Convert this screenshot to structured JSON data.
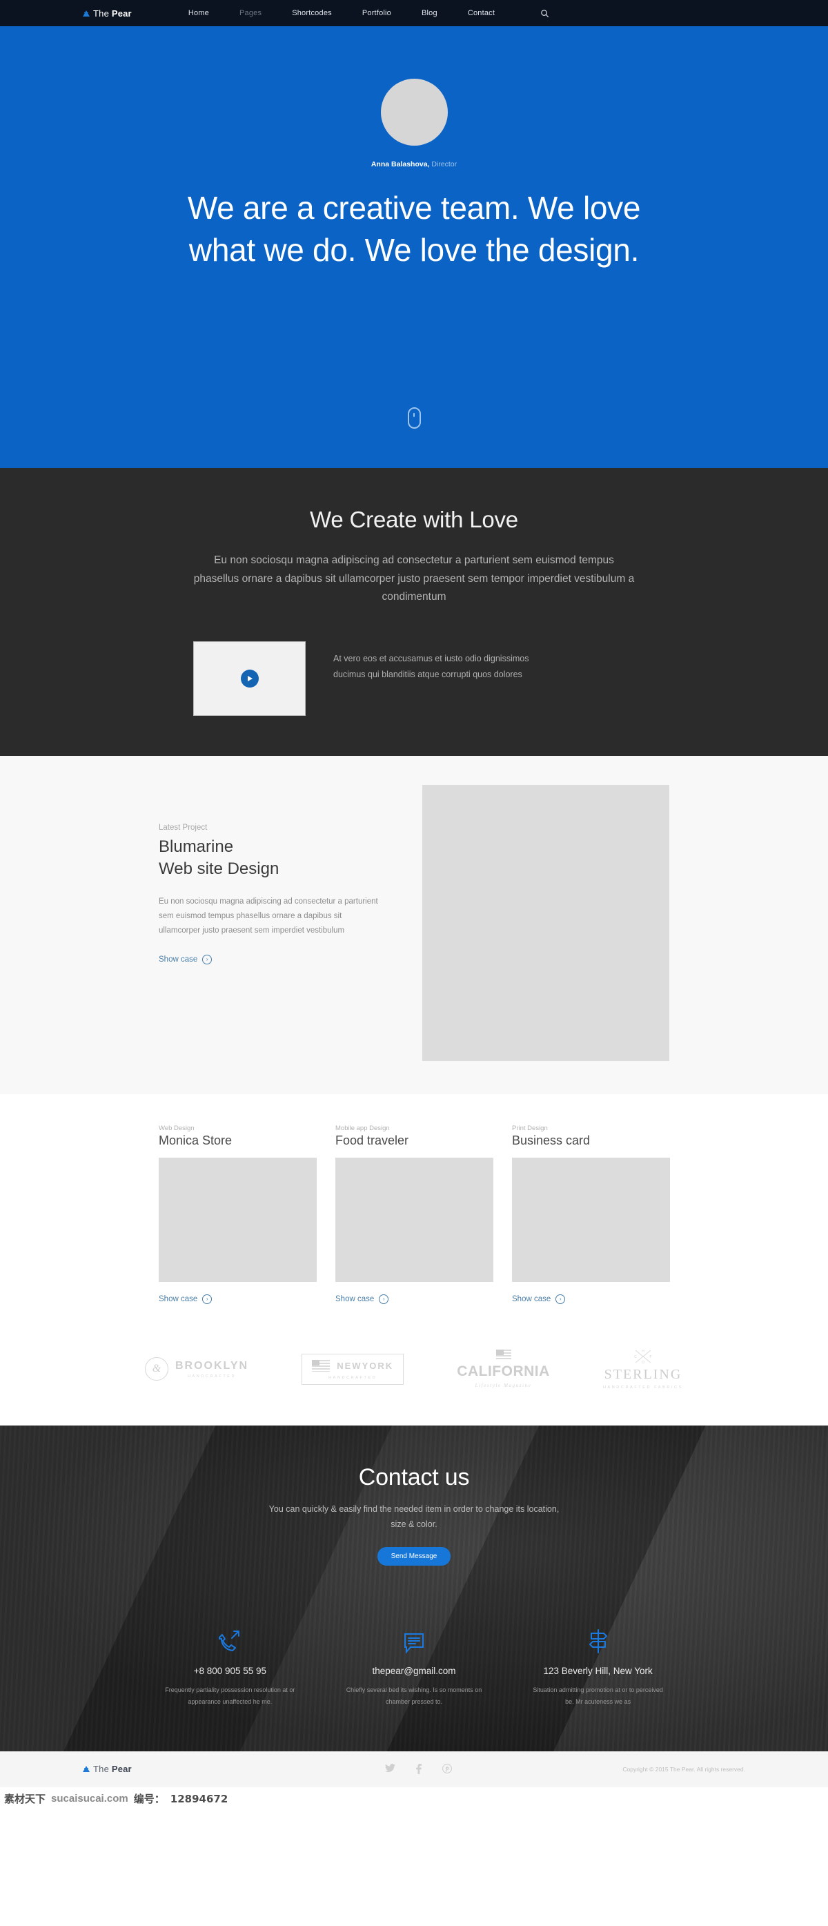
{
  "colors": {
    "hero_blue": "#0b63c5",
    "accent_blue": "#1677d8",
    "dark": "#2b2b2b",
    "link_blue": "#4a7fa8"
  },
  "nav": {
    "logo_prefix": "The ",
    "logo_bold": "Pear",
    "links": [
      {
        "label": "Home",
        "dim": false
      },
      {
        "label": "Pages",
        "dim": true
      },
      {
        "label": "Shortcodes",
        "dim": false
      },
      {
        "label": "Portfolio",
        "dim": false
      },
      {
        "label": "Blog",
        "dim": false
      },
      {
        "label": "Contact",
        "dim": false
      }
    ],
    "search_icon": "search-icon"
  },
  "hero": {
    "person_name": "Anna Balashova,",
    "person_role": " Director",
    "title": "We are a creative team. We love what we do. We love the design.",
    "scroll_icon": "mouse-scroll-icon"
  },
  "create": {
    "heading": "We Create with Love",
    "paragraph": "Eu non sociosqu magna adipiscing ad consectetur a parturient sem euismod tempus phasellus ornare a dapibus sit ullamcorper justo praesent sem tempor imperdiet vestibulum a condimentum",
    "play_icon": "play-icon",
    "video_text": "At vero eos et accusamus et iusto odio dignissimos ducimus qui blanditiis atque corrupti quos dolores"
  },
  "latest": {
    "eyebrow": "Latest Project",
    "title_line1": "Blumarine",
    "title_line2": "Web site Design",
    "paragraph": "Eu non sociosqu magna adipiscing ad consectetur a parturient sem euismod tempus phasellus ornare a dapibus sit ullamcorper justo praesent sem imperdiet vestibulum",
    "showcase_label": "Show case"
  },
  "cards": {
    "showcase_label": "Show case",
    "items": [
      {
        "eyebrow": "Web Design",
        "title": "Monica Store"
      },
      {
        "eyebrow": "Mobile app Design",
        "title": "Food traveler"
      },
      {
        "eyebrow": "Print Design",
        "title": "Business card"
      }
    ]
  },
  "brands": [
    {
      "mark": "&",
      "name": "BROOKLYN",
      "sub": "HANDCRAFTED"
    },
    {
      "name": "NEWYORK",
      "sub": "HANDCRAFTED"
    },
    {
      "name": "CALIFORNIA",
      "sub": "Lifestyle Magazine"
    },
    {
      "name": "STERLING",
      "sub": "HANDCRAFTED FABRICS"
    }
  ],
  "contact": {
    "heading": "Contact us",
    "subtitle": "You can quickly & easily find the needed item in order to change its location, size & color.",
    "button_label": "Send Message",
    "items": [
      {
        "icon": "phone-outgoing-icon",
        "value": "+8 800 905 55 95",
        "desc": "Frequently partiality possession resolution at or appearance unaffected he me."
      },
      {
        "icon": "chat-bubble-icon",
        "value": "thepear@gmail.com",
        "desc": "Chiefly several bed its wishing. Is so moments on chamber pressed to."
      },
      {
        "icon": "signpost-icon",
        "value": "123 Beverly Hill, New York",
        "desc": "Situation admitting promotion at or to perceived be. Mr acuteness we as"
      }
    ]
  },
  "footer": {
    "logo_prefix": "The ",
    "logo_bold": "Pear",
    "socials": [
      "twitter-icon",
      "facebook-icon",
      "pinterest-icon"
    ],
    "copyright": "Copyright © 2015 The Pear. All rights reserved."
  },
  "watermark": {
    "cn": "素材天下",
    "site": "sucaisucai.com",
    "id_label": "编号：",
    "id": "12894672"
  }
}
